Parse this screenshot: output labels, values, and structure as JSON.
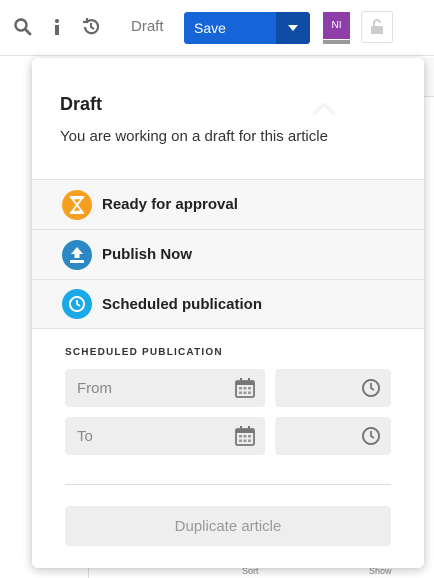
{
  "toolbar": {
    "draft_label": "Draft",
    "save_label": "Save",
    "avatar_initials": "NI",
    "icons": [
      "search-icon",
      "info-icon",
      "history-icon",
      "caret-down-icon",
      "lock-open-icon"
    ]
  },
  "background": {
    "sort_label": "Sort",
    "show_label": "Show"
  },
  "popover": {
    "title": "Draft",
    "description": "You are working on a draft for this article",
    "options": [
      {
        "label": "Ready for approval",
        "icon": "hourglass-icon",
        "color": "#f5a021"
      },
      {
        "label": "Publish Now",
        "icon": "upload-icon",
        "color": "#2c88c4"
      },
      {
        "label": "Scheduled publication",
        "icon": "clock-icon",
        "color": "#18a9e6"
      }
    ],
    "scheduled": {
      "heading": "SCHEDULED PUBLICATION",
      "from_placeholder": "From",
      "to_placeholder": "To"
    },
    "duplicate_label": "Duplicate article"
  },
  "colors": {
    "save": "#1565d8",
    "save_caret": "#0e4ca5",
    "avatar": "#8e3ea8"
  }
}
